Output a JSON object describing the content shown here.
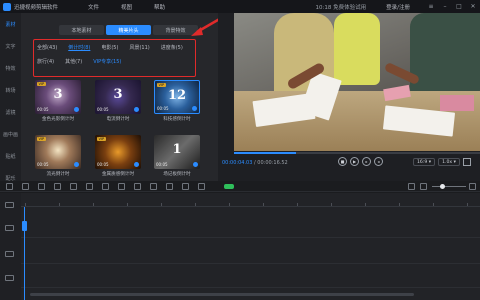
{
  "app": {
    "name": "迅捷视频剪辑软件"
  },
  "menu": [
    "文件",
    "视图",
    "帮助"
  ],
  "titlebar": {
    "trial": "10:18 免费体验试用",
    "login": "登录/注册"
  },
  "sidebar": [
    "素材",
    "文字",
    "特效",
    "转场",
    "滤镜",
    "画中画",
    "贴纸",
    "配乐"
  ],
  "tabs": [
    "本地素材",
    "精美片头",
    "背景特效"
  ],
  "categories": {
    "row1": [
      "全部(43)",
      "倒计时(8)",
      "电影(5)",
      "风景(11)",
      "进度条(5)"
    ],
    "row2": [
      "旅行(4)",
      "其他(7)",
      "VIP专享(15)"
    ]
  },
  "thumbs": [
    {
      "label": "金色光影倒计时",
      "duration": "00:05",
      "big": "3",
      "vip": "VIP"
    },
    {
      "label": "电流倒计时",
      "duration": "00:05",
      "big": "3",
      "vip": ""
    },
    {
      "label": "科技感倒计时",
      "duration": "00:05",
      "big": "12",
      "vip": "VIP"
    },
    {
      "label": "流光倒计时",
      "duration": "00:05",
      "big": "",
      "vip": "VIP"
    },
    {
      "label": "金属质感倒计时",
      "duration": "00:05",
      "big": "",
      "vip": "VIP"
    },
    {
      "label": "场记板倒计时",
      "duration": "00:05",
      "big": "1",
      "vip": ""
    }
  ],
  "player": {
    "current": "00:00:04.03",
    "total": "00:00:16.52",
    "ratio": "16:9",
    "speed": "1.0x",
    "progress": 0.25
  },
  "colors": {
    "accent": "#2b8cff",
    "highlight": "#e02b2b",
    "vip": "#d9a326"
  }
}
